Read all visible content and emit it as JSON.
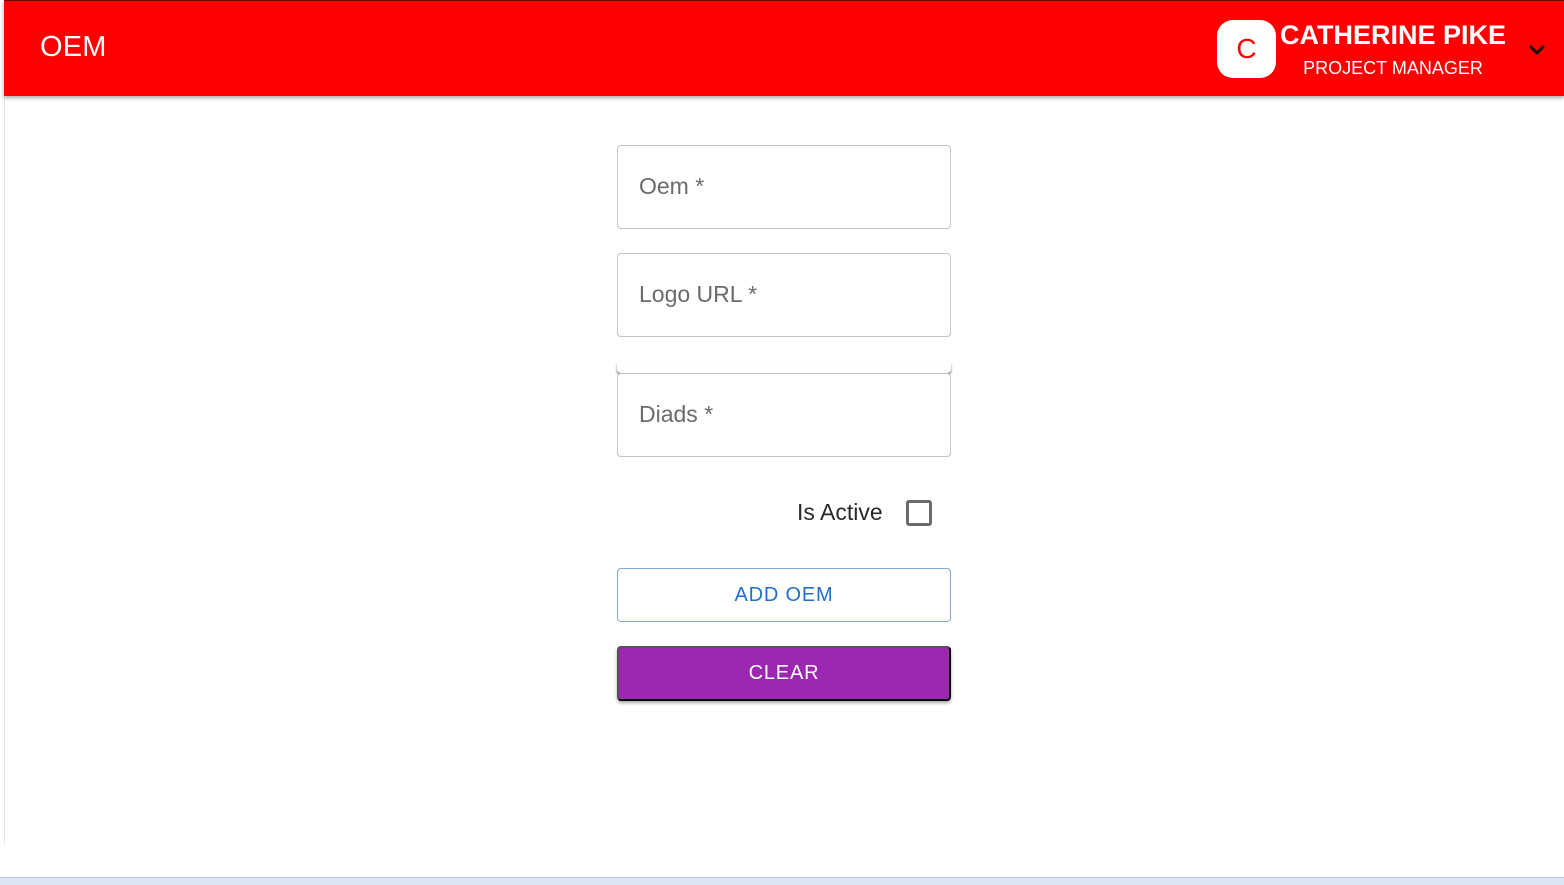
{
  "header": {
    "title": "OEM",
    "accent_color": "#ff0000",
    "user": {
      "avatar_initial": "C",
      "name": "CATHERINE PIKE",
      "role": "PROJECT MANAGER"
    },
    "menu_icon": "chevron-down-icon"
  },
  "form": {
    "oem_label": "Oem *",
    "logo_url_label": "Logo URL *",
    "diads_label": "Diads *",
    "is_active_label": "Is Active",
    "is_active_checked": false,
    "add_button_label": "ADD OEM",
    "clear_button_label": "CLEAR",
    "add_button_color": "#1f6fd1",
    "clear_button_color": "#9c27b0"
  }
}
